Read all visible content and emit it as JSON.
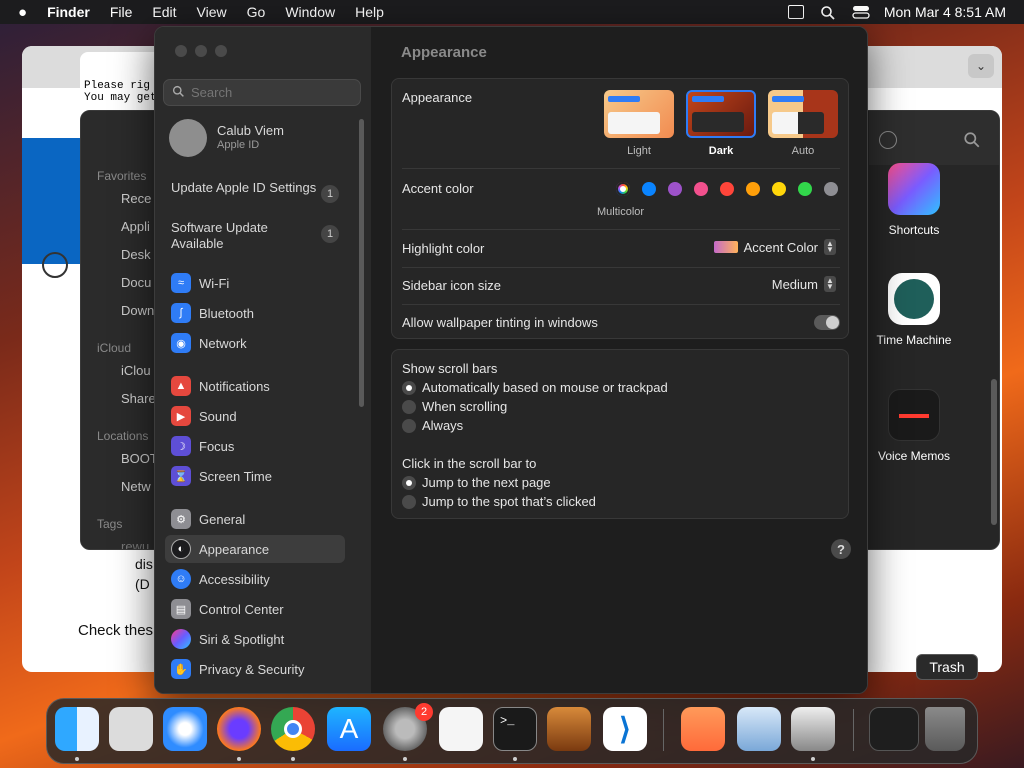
{
  "menubar": {
    "apple": "",
    "items": [
      "Finder",
      "File",
      "Edit",
      "View",
      "Go",
      "Window",
      "Help"
    ],
    "clock": "Mon Mar 4  8:51 AM"
  },
  "terminal": {
    "line1": "Please rig",
    "line2": "You may get"
  },
  "browser": {
    "text1": "dis",
    "text2": "(D",
    "text3": "Check thes"
  },
  "finder": {
    "sections": [
      "Favorites",
      "iCloud",
      "Locations",
      "Tags"
    ],
    "items": [
      "Rece",
      "Appli",
      "Desk",
      "Docu",
      "Down",
      "iClou",
      "Share",
      "BOOT",
      "Netw",
      "rewu"
    ],
    "apps": [
      "Shortcuts",
      "Time Machine",
      "Voice Memos"
    ]
  },
  "settings": {
    "search_placeholder": "Search",
    "user": {
      "name": "Calub Viem",
      "sub": "Apple ID"
    },
    "updates": [
      {
        "label": "Update Apple ID Settings",
        "badge": "1"
      },
      {
        "label": "Software Update Available",
        "badge": "1"
      }
    ],
    "sidebar": [
      {
        "label": "Wi-Fi",
        "color": "#2f7cf6"
      },
      {
        "label": "Bluetooth",
        "color": "#2f7cf6"
      },
      {
        "label": "Network",
        "color": "#2f7cf6"
      },
      {
        "label": "Notifications",
        "color": "#e5483e"
      },
      {
        "label": "Sound",
        "color": "#e5483e"
      },
      {
        "label": "Focus",
        "color": "#5e4fd6"
      },
      {
        "label": "Screen Time",
        "color": "#5e4fd6"
      },
      {
        "label": "General",
        "color": "#8e8e93"
      },
      {
        "label": "Appearance",
        "color": "#1c1c1e"
      },
      {
        "label": "Accessibility",
        "color": "#2f7cf6"
      },
      {
        "label": "Control Center",
        "color": "#8e8e93"
      },
      {
        "label": "Siri & Spotlight",
        "color": "#c64ad8"
      },
      {
        "label": "Privacy & Security",
        "color": "#2f7cf6"
      }
    ],
    "title": "Appearance",
    "appearance": {
      "label": "Appearance",
      "options": [
        "Light",
        "Dark",
        "Auto"
      ],
      "selected": "Dark"
    },
    "accent": {
      "label": "Accent color",
      "selected_label": "Multicolor",
      "colors": [
        "#b44bd3",
        "#0a84ff",
        "#9d52c9",
        "#f2508d",
        "#ff453a",
        "#ff9f0a",
        "#ffd60a",
        "#32d74b",
        "#8e8e93"
      ]
    },
    "highlight": {
      "label": "Highlight color",
      "value": "Accent Color"
    },
    "sidebar_icon": {
      "label": "Sidebar icon size",
      "value": "Medium"
    },
    "tinting": {
      "label": "Allow wallpaper tinting in windows"
    },
    "scroll": {
      "label": "Show scroll bars",
      "options": [
        "Automatically based on mouse or trackpad",
        "When scrolling",
        "Always"
      ]
    },
    "click": {
      "label": "Click in the scroll bar to",
      "options": [
        "Jump to the next page",
        "Jump to the spot that’s clicked"
      ]
    },
    "help": "?"
  },
  "dock": {
    "badge": "2",
    "tooltip": "Trash"
  }
}
